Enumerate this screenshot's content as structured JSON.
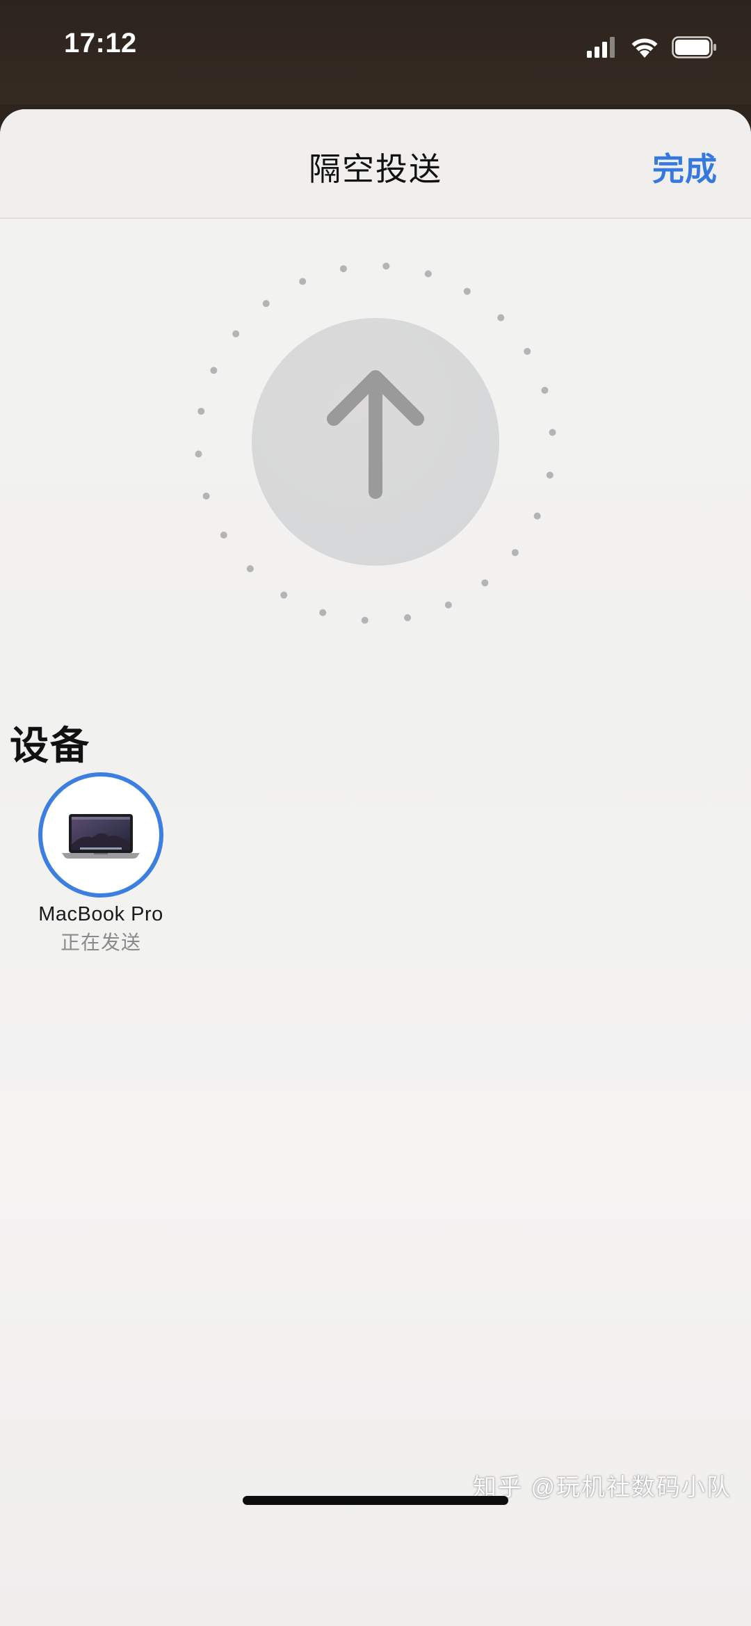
{
  "status_bar": {
    "time": "17:12",
    "icons": [
      "cellular-signal-icon",
      "wifi-icon",
      "battery-icon"
    ]
  },
  "sheet": {
    "title": "隔空投送",
    "done_label": "完成",
    "accent_color": "#3478e0"
  },
  "upload": {
    "icon": "arrow-up-icon"
  },
  "devices": {
    "heading": "设备",
    "items": [
      {
        "name": "MacBook Pro",
        "status": "正在发送",
        "icon": "laptop-icon",
        "ring_color": "#3d7fe0"
      }
    ]
  },
  "watermark": "知乎 @玩机社数码小队"
}
